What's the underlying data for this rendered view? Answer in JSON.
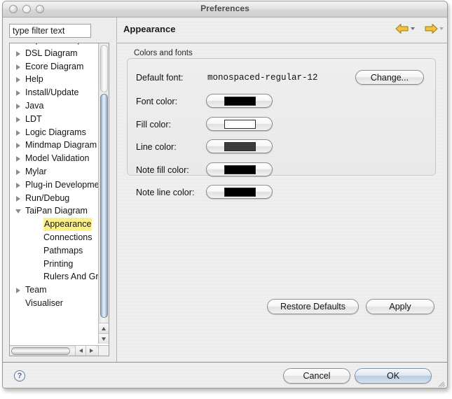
{
  "window": {
    "title": "Preferences",
    "controls": [
      "close-button",
      "minimize-button",
      "zoom-button"
    ]
  },
  "sidebar": {
    "filter": {
      "value": "type filter text",
      "placeholder": "type filter text"
    },
    "tree": [
      {
        "label": "AspectJ Compiler",
        "level": 0,
        "state": "collapsed",
        "selected": false,
        "clipped": true
      },
      {
        "label": "DSL Diagram",
        "level": 0,
        "state": "collapsed",
        "selected": false
      },
      {
        "label": "Ecore Diagram",
        "level": 0,
        "state": "collapsed",
        "selected": false
      },
      {
        "label": "Help",
        "level": 0,
        "state": "collapsed",
        "selected": false
      },
      {
        "label": "Install/Update",
        "level": 0,
        "state": "collapsed",
        "selected": false
      },
      {
        "label": "Java",
        "level": 0,
        "state": "collapsed",
        "selected": false
      },
      {
        "label": "LDT",
        "level": 0,
        "state": "collapsed",
        "selected": false
      },
      {
        "label": "Logic Diagrams",
        "level": 0,
        "state": "collapsed",
        "selected": false
      },
      {
        "label": "Mindmap Diagram",
        "level": 0,
        "state": "collapsed",
        "selected": false
      },
      {
        "label": "Model Validation",
        "level": 0,
        "state": "collapsed",
        "selected": false
      },
      {
        "label": "Mylar",
        "level": 0,
        "state": "collapsed",
        "selected": false
      },
      {
        "label": "Plug-in Development",
        "level": 0,
        "state": "collapsed",
        "selected": false
      },
      {
        "label": "Run/Debug",
        "level": 0,
        "state": "collapsed",
        "selected": false
      },
      {
        "label": "TaiPan Diagram",
        "level": 0,
        "state": "expanded",
        "selected": false
      },
      {
        "label": "Appearance",
        "level": 1,
        "state": "leaf",
        "selected": true
      },
      {
        "label": "Connections",
        "level": 1,
        "state": "leaf",
        "selected": false
      },
      {
        "label": "Pathmaps",
        "level": 1,
        "state": "leaf",
        "selected": false
      },
      {
        "label": "Printing",
        "level": 1,
        "state": "leaf",
        "selected": false
      },
      {
        "label": "Rulers And Grid",
        "level": 1,
        "state": "leaf",
        "selected": false
      },
      {
        "label": "Team",
        "level": 0,
        "state": "collapsed",
        "selected": false
      },
      {
        "label": "Visualiser",
        "level": 0,
        "state": "leaf",
        "selected": false
      }
    ]
  },
  "page": {
    "title": "Appearance",
    "nav": {
      "back_icon": "back-arrow-icon",
      "back_menu_icon": "chevron-down-icon",
      "forward_icon": "forward-arrow-icon",
      "forward_menu_icon": "chevron-down-icon",
      "arrow_color": "#e8b32c"
    },
    "group": {
      "label": "Colors and fonts",
      "default_font": {
        "label": "Default font:",
        "value": "monospaced-regular-12",
        "change_button": "Change..."
      },
      "colors": [
        {
          "label": "Font color:",
          "value": "#000000",
          "name": "font-color"
        },
        {
          "label": "Fill color:",
          "value": "#ffffff",
          "name": "fill-color"
        },
        {
          "label": "Line color:",
          "value": "#3d3d3d",
          "name": "line-color"
        },
        {
          "label": "Note fill color:",
          "value": "#000000",
          "name": "note-fill-color"
        },
        {
          "label": "Note line color:",
          "value": "#000000",
          "name": "note-line-color"
        }
      ]
    },
    "restore_defaults": "Restore Defaults",
    "apply": "Apply"
  },
  "footer": {
    "help_icon": "help-question-icon",
    "cancel": "Cancel",
    "ok": "OK"
  }
}
